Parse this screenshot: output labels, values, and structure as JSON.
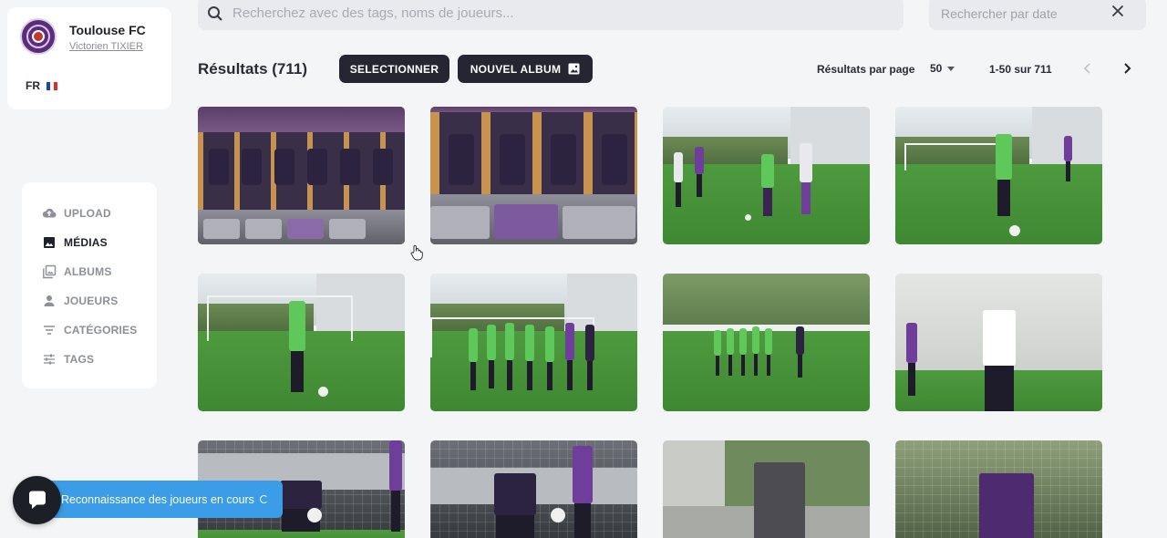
{
  "club": {
    "name": "Toulouse FC",
    "user": "Victorien TIXIER",
    "language": "FR"
  },
  "nav": {
    "items": [
      {
        "label": "UPLOAD",
        "icon": "cloud-upload-icon",
        "active": false
      },
      {
        "label": "MÉDIAS",
        "icon": "image-icon",
        "active": true
      },
      {
        "label": "ALBUMS",
        "icon": "albums-icon",
        "active": false
      },
      {
        "label": "JOUEURS",
        "icon": "person-icon",
        "active": false
      },
      {
        "label": "CATÉGORIES",
        "icon": "filter-lines-icon",
        "active": false
      },
      {
        "label": "TAGS",
        "icon": "sliders-icon",
        "active": false
      }
    ]
  },
  "search": {
    "main_placeholder": "Recherchez avec des tags, noms de joueurs...",
    "date_placeholder": "Rechercher par date"
  },
  "results": {
    "title": "Résultats (711)",
    "select_label": "SELECTIONNER",
    "new_album_label": "NOUVEL ALBUM",
    "per_page_label": "Résultats par page",
    "per_page_value": "50",
    "range": "1-50 sur 711"
  },
  "photos": [
    {
      "scene": "locker-room"
    },
    {
      "scene": "locker-room"
    },
    {
      "scene": "training-duel"
    },
    {
      "scene": "training-dribble"
    },
    {
      "scene": "training-ball"
    },
    {
      "scene": "team-huddle"
    },
    {
      "scene": "team-huddle"
    },
    {
      "scene": "player-portrait"
    },
    {
      "scene": "goalkeeper-save"
    },
    {
      "scene": "goalkeeper-save"
    },
    {
      "scene": "coach"
    },
    {
      "scene": "goalkeeper-portrait"
    }
  ],
  "toast": {
    "text": "Reconnaissance des joueurs en cours"
  },
  "colors": {
    "accent_dark": "#262633",
    "toast_blue": "#3b9de8",
    "club_purple": "#5b2c7a"
  }
}
